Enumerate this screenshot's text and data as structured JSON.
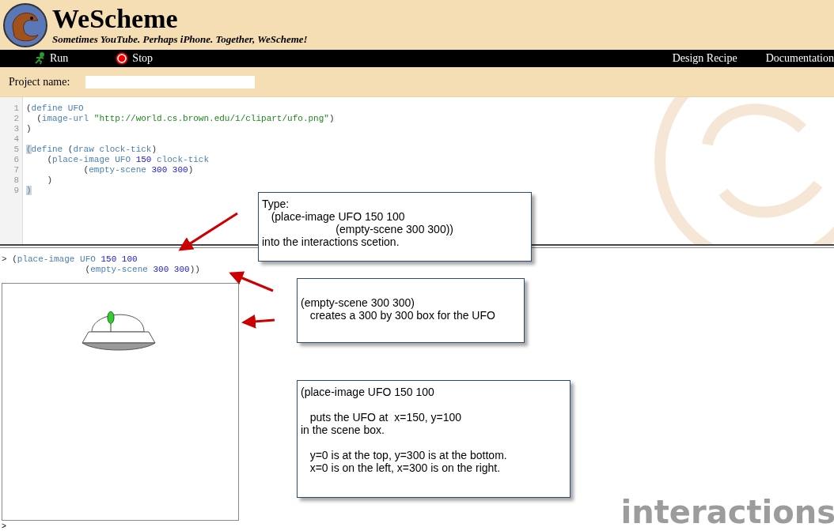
{
  "header": {
    "title": "WeScheme",
    "tagline": "Sometimes YouTube. Perhaps iPhone. Together, WeScheme!"
  },
  "toolbar": {
    "left": [
      {
        "label": "Run",
        "kind": "run"
      },
      {
        "label": "Stop",
        "kind": "stop"
      }
    ],
    "right": [
      {
        "label": "Design Recipe"
      },
      {
        "label": "Documentation"
      }
    ]
  },
  "project": {
    "label": "Project name:"
  },
  "editor": {
    "lines": [
      {
        "number": "1",
        "tokens": [
          {
            "text": "(",
            "kind": "paren"
          },
          {
            "text": "define UFO",
            "kind": "symbol"
          }
        ]
      },
      {
        "number": "2",
        "tokens": [
          {
            "text": "  (",
            "kind": "paren"
          },
          {
            "text": "image-url",
            "kind": "symbol"
          },
          {
            "text": " \"http://world.cs.brown.edu/1/clipart/ufo.png\"",
            "kind": "string"
          },
          {
            "text": ")",
            "kind": "paren"
          }
        ]
      },
      {
        "number": "3",
        "tokens": [
          {
            "text": ")",
            "kind": "paren"
          }
        ]
      },
      {
        "number": "4"
      },
      {
        "number": "5",
        "tokens": [
          {
            "text": "(",
            "kind": "match"
          },
          {
            "text": "define",
            "kind": "symbol"
          },
          {
            "text": " (",
            "kind": "paren"
          },
          {
            "text": "draw clock-tick",
            "kind": "symbol"
          },
          {
            "text": ")",
            "kind": "paren"
          }
        ]
      },
      {
        "number": "6",
        "tokens": [
          {
            "text": "    (",
            "kind": "paren"
          },
          {
            "text": "place-image UFO",
            "kind": "symbol"
          },
          {
            "text": " 150",
            "kind": "number"
          },
          {
            "text": " clock-tick",
            "kind": "symbol"
          }
        ]
      },
      {
        "number": "7",
        "tokens": [
          {
            "text": "           (",
            "kind": "paren"
          },
          {
            "text": "empty-scene",
            "kind": "symbol"
          },
          {
            "text": " 300 300",
            "kind": "number"
          },
          {
            "text": ")",
            "kind": "paren"
          }
        ]
      },
      {
        "number": "8",
        "tokens": [
          {
            "text": "    )",
            "kind": "paren"
          }
        ]
      },
      {
        "number": "9",
        "tokens": [
          {
            "text": ")",
            "kind": "match"
          }
        ]
      }
    ]
  },
  "interactions": {
    "lines": [
      {
        "tokens": [
          {
            "text": "> (",
            "kind": "paren"
          },
          {
            "text": "place-image UFO",
            "kind": "symbol"
          },
          {
            "text": " 150 100",
            "kind": "number"
          }
        ]
      },
      {
        "tokens": [
          {
            "text": "                (",
            "kind": "paren"
          },
          {
            "text": "empty-scene",
            "kind": "symbol"
          },
          {
            "text": " 300 300",
            "kind": "number"
          },
          {
            "text": "))",
            "kind": "paren"
          }
        ]
      }
    ],
    "prompt": ">",
    "label": "interactions"
  },
  "callouts": [
    {
      "text": "Type:\n   (place-image UFO 150 100\n                        (empty-scene 300 300))\ninto the interactions scetion."
    },
    {
      "text": "\n(empty-scene 300 300)\n   creates a 300 by 300 box for the UFO"
    },
    {
      "text": "(place-image UFO 150 100\n\n   puts the UFO at  x=150, y=100\nin the scene box.\n\n   y=0 is at the top, y=300 is at the bottom.\n   x=0 is on the left, x=300 is on the right."
    }
  ]
}
